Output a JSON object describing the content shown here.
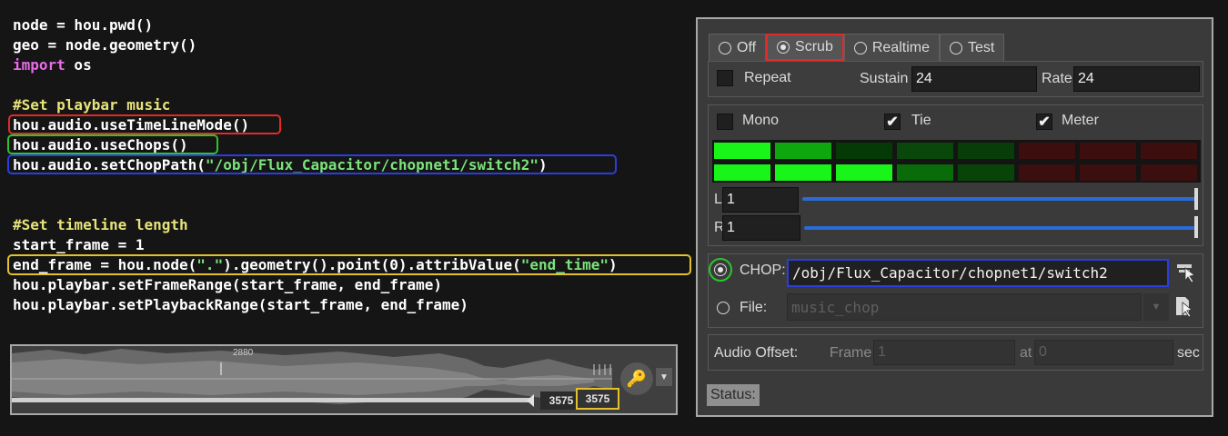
{
  "code": {
    "lines": [
      "node = hou.pwd()",
      "geo = node.geometry()",
      "import",
      " os",
      "#Set playbar music",
      "hou.audio.useTimeLineMode()",
      "hou.audio.useChops()",
      "hou.audio.setChopPath(",
      "\"/obj/Flux_Capacitor/chopnet1/switch2\"",
      ")",
      "#Set timeline length",
      "start_frame = 1",
      "end_frame = hou.node(",
      "\".\"",
      ").geometry().point(0).attribValue(",
      "\"end_time\"",
      ")",
      "hou.playbar.setFrameRange(start_frame, end_frame)",
      "hou.playbar.setPlaybackRange(start_frame, end_frame)"
    ]
  },
  "timeline": {
    "marker_label": "2880",
    "current_frame": "3575",
    "end_frame": "3575"
  },
  "panel": {
    "mode_tabs": [
      {
        "label": "Off",
        "selected": false
      },
      {
        "label": "Scrub",
        "selected": true
      },
      {
        "label": "Realtime",
        "selected": false
      },
      {
        "label": "Test",
        "selected": false
      }
    ],
    "repeat_label": "Repeat",
    "sustain_label": "Sustain",
    "sustain_value": "24",
    "rate_label": "Rate",
    "rate_value": "24",
    "mono_label": "Mono",
    "tie_label": "Tie",
    "meter_label": "Meter",
    "left_label": "L",
    "left_value": "1",
    "right_label": "R",
    "right_value": "1",
    "chop_label": "CHOP:",
    "chop_path": "/obj/Flux_Capacitor/chopnet1/switch2",
    "file_label": "File:",
    "file_placeholder": "music_chop",
    "audio_offset_label": "Audio Offset:",
    "frame_label": "Frame",
    "frame_value": "1",
    "at_label": "at",
    "at_value": "0",
    "sec_label": "sec",
    "status_label": "Status:"
  },
  "colors": {
    "highlight_red": "#e12a2a",
    "highlight_green": "#2bc52b",
    "highlight_blue": "#2a3ee0",
    "highlight_yellow": "#e3c12e",
    "meter_bright": "#19f519",
    "meter_dark_red": "#3c0e0e"
  }
}
